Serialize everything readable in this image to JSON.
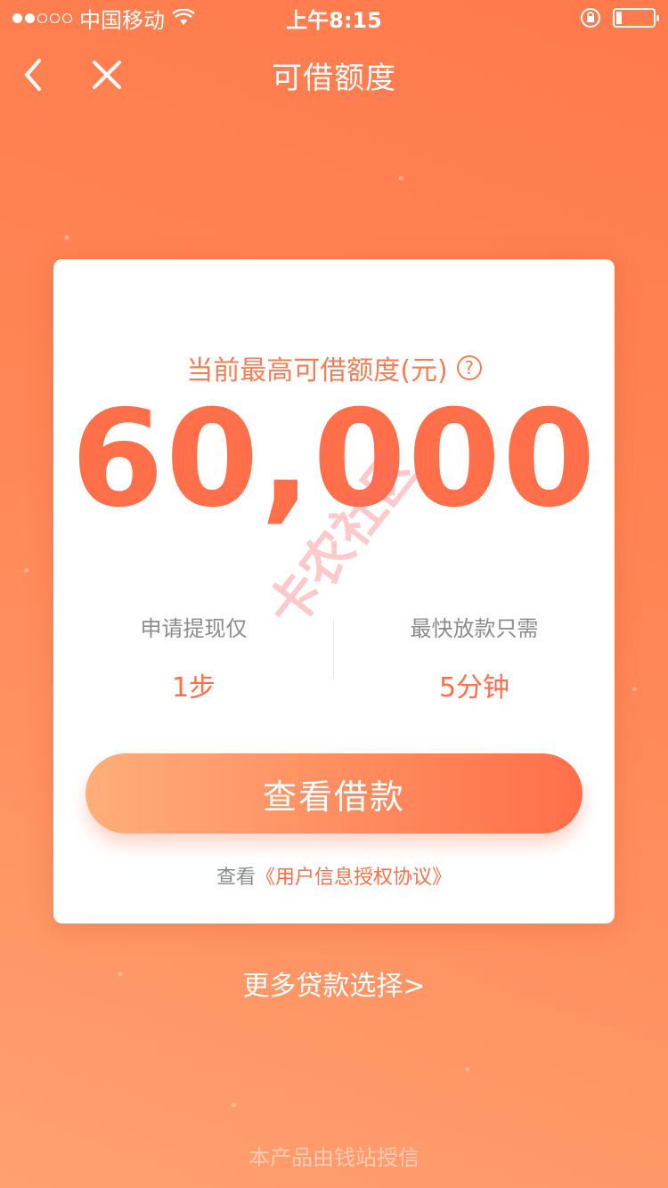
{
  "status_bar": {
    "carrier": "中国移动",
    "time": "上午8:15",
    "battery_level": 0.15
  },
  "nav": {
    "title": "可借额度"
  },
  "card": {
    "limit_label": "当前最高可借额度(元)",
    "help_symbol": "?",
    "amount": "60,000",
    "stats": [
      {
        "label": "申请提现仅",
        "value": "1步"
      },
      {
        "label": "最快放款只需",
        "value": "5分钟"
      }
    ],
    "cta_label": "查看借款",
    "agreement_prefix": "查看",
    "agreement_link": "《用户信息授权协议》"
  },
  "watermark": "卡农社区",
  "more_link": "更多贷款选择>",
  "footer": "本产品由钱站授信",
  "colors": {
    "accent": "#ff6f4a",
    "background": "#ff8656"
  }
}
